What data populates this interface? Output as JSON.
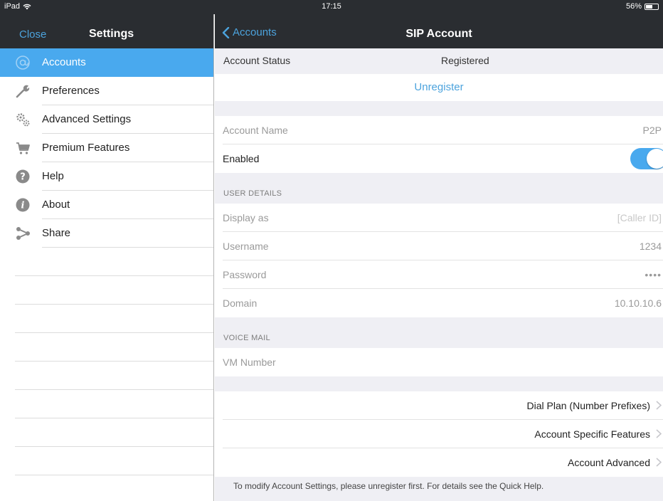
{
  "statusbar": {
    "carrier": "iPad",
    "time": "17:15",
    "battery": "56%",
    "battery_level": 0.56
  },
  "sidebar": {
    "close_label": "Close",
    "title": "Settings",
    "items": [
      {
        "label": "Accounts",
        "icon": "at-icon",
        "active": true
      },
      {
        "label": "Preferences",
        "icon": "wrench-icon"
      },
      {
        "label": "Advanced Settings",
        "icon": "gears-icon"
      },
      {
        "label": "Premium Features",
        "icon": "cart-icon"
      },
      {
        "label": "Help",
        "icon": "help-icon"
      },
      {
        "label": "About",
        "icon": "info-icon"
      },
      {
        "label": "Share",
        "icon": "share-icon"
      }
    ]
  },
  "main": {
    "back_label": "Accounts",
    "title": "SIP Account",
    "account_status_label": "Account Status",
    "account_status_value": "Registered",
    "unregister_label": "Unregister",
    "account_name_label": "Account Name",
    "account_name_value": "P2P",
    "enabled_label": "Enabled",
    "enabled_value": true,
    "user_details_header": "USER DETAILS",
    "display_as_label": "Display as",
    "display_as_placeholder": "[Caller ID]",
    "username_label": "Username",
    "username_value": "1234",
    "password_label": "Password",
    "password_value": "••••",
    "domain_label": "Domain",
    "domain_value": "10.10.10.6",
    "voice_mail_header": "VOICE MAIL",
    "vm_number_label": "VM Number",
    "dial_plan_label": "Dial Plan (Number Prefixes)",
    "account_specific_label": "Account Specific Features",
    "account_advanced_label": "Account Advanced",
    "footnote": "To modify Account Settings, please unregister first.  For details see the Quick Help."
  },
  "colors": {
    "accent": "#49a9ee",
    "link": "#4ca3dd",
    "bar": "#2a2d31"
  }
}
